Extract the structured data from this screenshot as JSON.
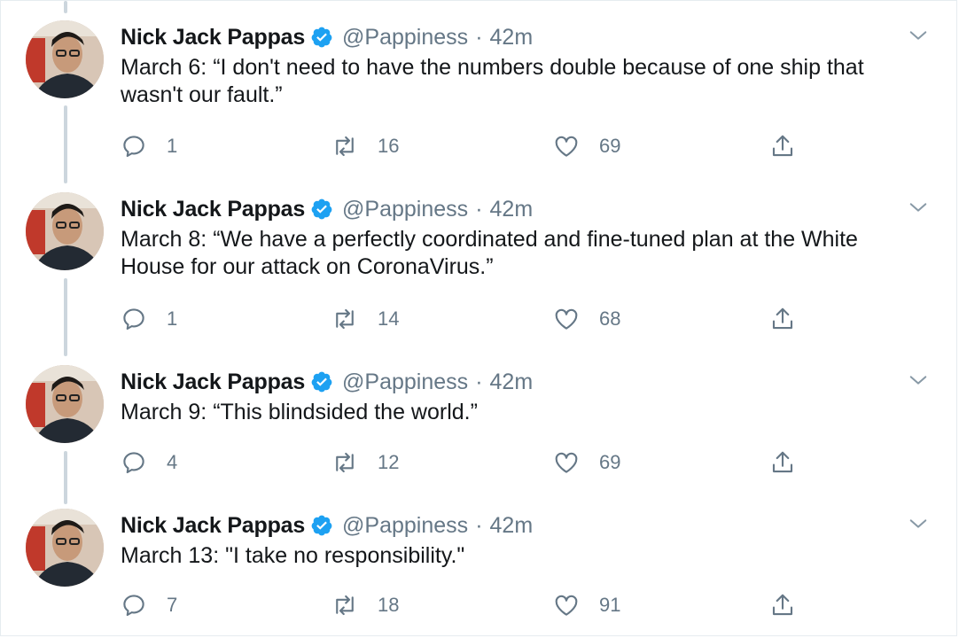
{
  "tweets": [
    {
      "author": "Nick Jack Pappas",
      "handle": "@Pappiness",
      "separator": "·",
      "time": "42m",
      "text_lines": [
        "March 6: “I don't need to have the numbers double because of one ship that",
        "wasn't our fault.”"
      ],
      "replies": "1",
      "retweets": "16",
      "likes": "69"
    },
    {
      "author": "Nick Jack Pappas",
      "handle": "@Pappiness",
      "separator": "·",
      "time": "42m",
      "text_lines": [
        "March 8: “We have a perfectly coordinated and fine-tuned plan at the White",
        "House for our attack on CoronaVirus.”"
      ],
      "replies": "1",
      "retweets": "14",
      "likes": "68"
    },
    {
      "author": "Nick Jack Pappas",
      "handle": "@Pappiness",
      "separator": "·",
      "time": "42m",
      "text_lines": [
        "March 9: “This blindsided the world.”"
      ],
      "replies": "4",
      "retweets": "12",
      "likes": "69"
    },
    {
      "author": "Nick Jack Pappas",
      "handle": "@Pappiness",
      "separator": "·",
      "time": "42m",
      "text_lines": [
        "March 13: \"I take no responsibility.\""
      ],
      "replies": "7",
      "retweets": "18",
      "likes": "91"
    }
  ],
  "icons": {
    "verified": "verified-badge-icon",
    "more": "chevron-down-icon",
    "reply": "reply-icon",
    "retweet": "retweet-icon",
    "like": "heart-icon",
    "share": "share-icon"
  },
  "colors": {
    "verified_blue": "#1da1f2",
    "secondary_text": "#657786",
    "thread_line": "#ccd6dd"
  }
}
